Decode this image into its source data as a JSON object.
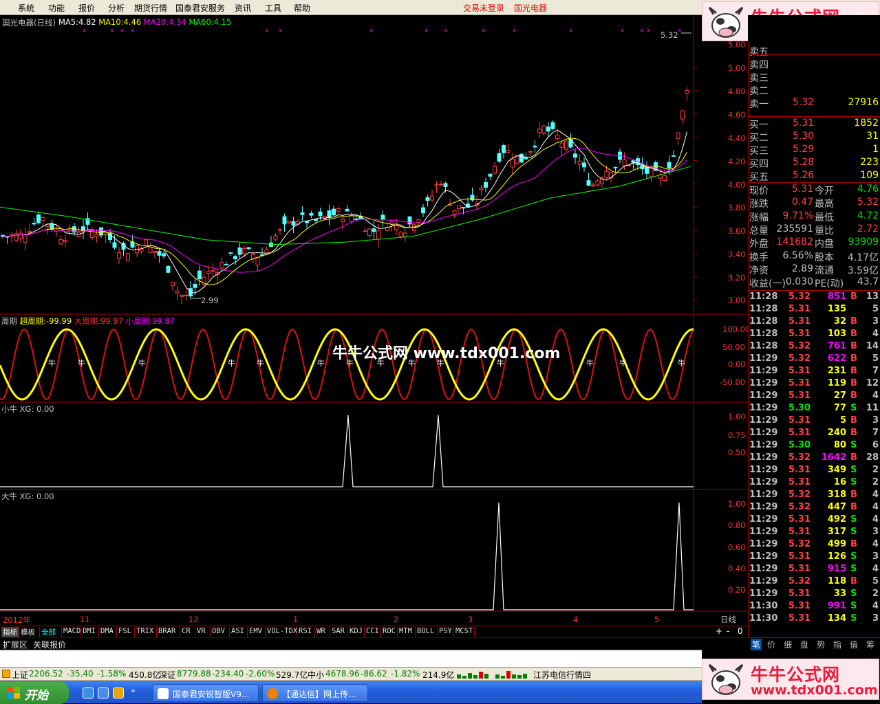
{
  "menu": {
    "items": [
      "系统",
      "功能",
      "报价",
      "分析",
      "期货行情",
      "国泰君安服务",
      "资讯",
      "工具",
      "帮助"
    ],
    "trade_status": "交易未登录",
    "stock_title": "国光电器"
  },
  "logo": {
    "title": "牛牛公式网",
    "url": "www.tdx001.com"
  },
  "main_chart": {
    "header_title": "国光电器(日线)",
    "ma": [
      {
        "label": "MA5:",
        "value": "4.82",
        "color": "#ffffff"
      },
      {
        "label": "MA10:",
        "value": "4.46",
        "color": "#ffff00"
      },
      {
        "label": "MA20:",
        "value": "4.34",
        "color": "#ff00ff"
      },
      {
        "label": "MA60:",
        "value": "4.15",
        "color": "#00ff00"
      }
    ],
    "y_labels": [
      "5.00",
      "4.80",
      "4.60",
      "4.40",
      "4.20",
      "4.00",
      "3.80",
      "3.60",
      "3.40",
      "3.20",
      "3.00"
    ],
    "high_label": "5.32",
    "low_label": "2.99",
    "watermark": "牛牛公式网 www.tdx001.com"
  },
  "cycle_panel": {
    "name": "周期",
    "l1": "超周期:",
    "v1": "-99.99",
    "l2": "大周期:",
    "v2": "99.97",
    "l3": "小周期:",
    "v3": "99.87",
    "y_labels": [
      "100.00",
      "50.00",
      "0.00",
      "-50.00"
    ],
    "marker": "牛"
  },
  "small_panel": {
    "name": "小牛",
    "xg": "XG: 0.00",
    "y_labels": [
      "1.00",
      "0.75",
      "0.50"
    ]
  },
  "big_panel": {
    "name": "大牛",
    "xg": "XG: 0.00",
    "y_labels": [
      "1.00",
      "0.80",
      "0.60",
      "0.40",
      "0.20"
    ]
  },
  "x_axis": {
    "labels": [
      "2012年",
      "11",
      "12",
      "1",
      "2",
      "3",
      "4",
      "5"
    ],
    "period": "日线"
  },
  "indicator_tabs": [
    "指标",
    "模板",
    "全部",
    "MACD",
    "DMI",
    "DMA",
    "FSL",
    "TRIX",
    "BRAR",
    "CR",
    "VR",
    "OBV",
    "ASI",
    "EMV",
    "VOL-TDX",
    "RSI",
    "WR",
    "SAR",
    "KDJ",
    "CCI",
    "ROC",
    "MTM",
    "BOLL",
    "PSY",
    "MCST"
  ],
  "zoom_buttons": [
    "+",
    "-",
    "0"
  ],
  "sub_tabs": [
    "扩展区",
    "关联报价"
  ],
  "quote": {
    "sells": [
      {
        "label": "卖五",
        "price": "",
        "vol": ""
      },
      {
        "label": "卖四",
        "price": "",
        "vol": ""
      },
      {
        "label": "卖三",
        "price": "",
        "vol": ""
      },
      {
        "label": "卖二",
        "price": "",
        "vol": ""
      },
      {
        "label": "卖一",
        "price": "5.32",
        "vol": "27916"
      }
    ],
    "buys": [
      {
        "label": "买一",
        "price": "5.31",
        "vol": "1852"
      },
      {
        "label": "买二",
        "price": "5.30",
        "vol": "31"
      },
      {
        "label": "买三",
        "price": "5.29",
        "vol": "1"
      },
      {
        "label": "买四",
        "price": "5.28",
        "vol": "223"
      },
      {
        "label": "买五",
        "price": "5.26",
        "vol": "109"
      }
    ],
    "stats": [
      {
        "l1": "现价",
        "v1": "5.31",
        "c1": "#ff4040",
        "l2": "今开",
        "v2": "4.76",
        "c2": "#00e000"
      },
      {
        "l1": "涨跌",
        "v1": "0.47",
        "c1": "#ff4040",
        "l2": "最高",
        "v2": "5.32",
        "c2": "#ff4040"
      },
      {
        "l1": "涨幅",
        "v1": "9.71%",
        "c1": "#ff4040",
        "l2": "最低",
        "v2": "4.72",
        "c2": "#00e000"
      },
      {
        "l1": "总量",
        "v1": "235591",
        "c1": "#c0c0c0",
        "l2": "量比",
        "v2": "2.72",
        "c2": "#ff4040"
      },
      {
        "l1": "外盘",
        "v1": "141682",
        "c1": "#ff4040",
        "l2": "内盘",
        "v2": "93909",
        "c2": "#00e000"
      },
      {
        "l1": "换手",
        "v1": "6.56%",
        "c1": "#c0c0c0",
        "l2": "股本",
        "v2": "4.17亿",
        "c2": "#c0c0c0"
      },
      {
        "l1": "净资",
        "v1": "2.89",
        "c1": "#c0c0c0",
        "l2": "流通",
        "v2": "3.59亿",
        "c2": "#c0c0c0"
      },
      {
        "l1": "收益(一)",
        "v1": "0.030",
        "c1": "#c0c0c0",
        "l2": "PE(动)",
        "v2": "43.7",
        "c2": "#c0c0c0"
      }
    ],
    "trades": [
      [
        "11:28",
        "5.32",
        "851",
        "B",
        "13"
      ],
      [
        "11:28",
        "5.31",
        "135",
        "",
        "5"
      ],
      [
        "11:28",
        "5.31",
        "32",
        "B",
        "3"
      ],
      [
        "11:28",
        "5.31",
        "103",
        "B",
        "4"
      ],
      [
        "11:28",
        "5.32",
        "761",
        "B",
        "14"
      ],
      [
        "11:29",
        "5.32",
        "622",
        "B",
        "5"
      ],
      [
        "11:29",
        "5.31",
        "231",
        "B",
        "7"
      ],
      [
        "11:29",
        "5.31",
        "119",
        "B",
        "12"
      ],
      [
        "11:29",
        "5.31",
        "27",
        "B",
        "4"
      ],
      [
        "11:29",
        "5.30",
        "77",
        "S",
        "11"
      ],
      [
        "11:29",
        "5.31",
        "5",
        "B",
        "3"
      ],
      [
        "11:29",
        "5.31",
        "240",
        "B",
        "7"
      ],
      [
        "11:29",
        "5.30",
        "80",
        "S",
        "6"
      ],
      [
        "11:29",
        "5.32",
        "1642",
        "B",
        "28"
      ],
      [
        "11:29",
        "5.31",
        "349",
        "S",
        "2"
      ],
      [
        "11:29",
        "5.31",
        "16",
        "S",
        "2"
      ],
      [
        "11:29",
        "5.32",
        "318",
        "B",
        "4"
      ],
      [
        "11:29",
        "5.32",
        "447",
        "B",
        "4"
      ],
      [
        "11:29",
        "5.31",
        "492",
        "S",
        "4"
      ],
      [
        "11:29",
        "5.31",
        "317",
        "S",
        "3"
      ],
      [
        "11:29",
        "5.32",
        "499",
        "B",
        "4"
      ],
      [
        "11:29",
        "5.31",
        "126",
        "S",
        "3"
      ],
      [
        "11:29",
        "5.31",
        "915",
        "S",
        "4"
      ],
      [
        "11:29",
        "5.32",
        "118",
        "B",
        "5"
      ],
      [
        "11:29",
        "5.31",
        "33",
        "S",
        "2"
      ],
      [
        "11:30",
        "5.31",
        "991",
        "S",
        "4"
      ],
      [
        "11:30",
        "5.31",
        "134",
        "S",
        "3"
      ]
    ],
    "tabs": [
      "笔",
      "价",
      "细",
      "盘",
      "势",
      "指",
      "值",
      "筹"
    ]
  },
  "status": {
    "sh_name": "上证",
    "sh_val": "2206.52",
    "sh_chg": "-35.40",
    "sh_pct": "-1.58%",
    "sh_amt": "450.8亿",
    "sz_name": "深证",
    "sz_val": "8779.88",
    "sz_chg": "-234.40",
    "sz_pct": "-2.60%",
    "sz_amt": "529.7亿",
    "zx_name": "中小",
    "zx_val": "4678.96",
    "zx_chg": "-86.62",
    "zx_pct": "-1.82%",
    "zx_amt": "214.9亿",
    "server": "江苏电信行情四"
  },
  "taskbar": {
    "start": "开始",
    "tasks": [
      "国泰君安锐智版V9...",
      "【通达信】网上传..."
    ]
  }
}
